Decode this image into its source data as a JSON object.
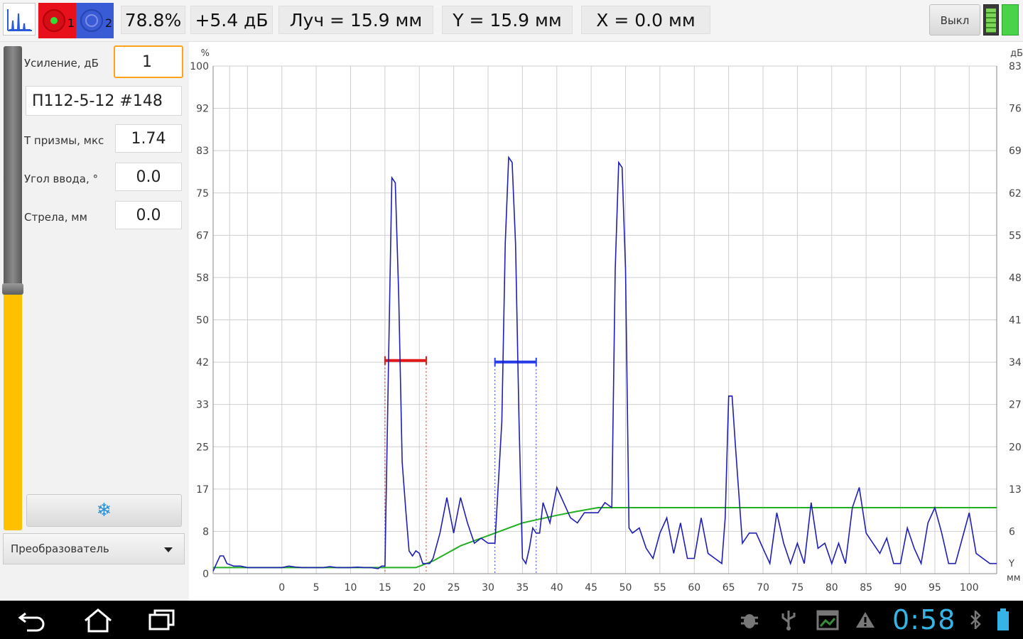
{
  "topbar": {
    "channel1_num": "1",
    "channel2_num": "2",
    "amplitude": "78.8%",
    "gain_delta": "+5.4 дБ",
    "beam": "Луч = 15.9 мм",
    "y_coord": "Y = 15.9 мм",
    "x_coord": "X = 0.0 мм",
    "off_label": "Выкл"
  },
  "left": {
    "gain_label": "Усиление, дБ",
    "gain_value": "1",
    "probe_name": "П112-5-12 #148",
    "prism_label": "Т призмы, мкс",
    "prism_value": "1.74",
    "angle_label": "Угол ввода, °",
    "angle_value": "0.0",
    "arrow_label": "Стрела, мм",
    "arrow_value": "0.0",
    "freeze_icon": "❄",
    "probe_select": "Преобразователь"
  },
  "colors": {
    "signal": "#1f1fb4",
    "dac": "#22b022",
    "gate1": "#e01818",
    "gate2": "#2a3ee8",
    "grid": "#cfcfcf",
    "clock": "#35b5e5"
  },
  "chart_data": {
    "type": "line",
    "xlim": [
      -10,
      104
    ],
    "ylim": [
      0,
      100
    ],
    "x_ticks": [
      0,
      5,
      10,
      15,
      20,
      25,
      30,
      35,
      40,
      45,
      50,
      55,
      60,
      65,
      70,
      75,
      80,
      85,
      90,
      95,
      100
    ],
    "y_ticks_left": [
      "0",
      "8",
      "17",
      "25",
      "33",
      "42",
      "50",
      "58",
      "67",
      "75",
      "83",
      "92",
      "100"
    ],
    "y_ticks_right": [
      "83",
      "76",
      "69",
      "62",
      "55",
      "48",
      "41",
      "34",
      "27",
      "20",
      "13",
      "6"
    ],
    "left_unit": "%",
    "right_unit": "дБ",
    "x_unit_top": "Y",
    "x_unit_bottom": "мм",
    "signal": {
      "x": [
        -10,
        -9.5,
        -9,
        -8.5,
        -8,
        -7,
        -6,
        -5,
        -4,
        -3,
        -2,
        -1,
        0,
        1,
        2,
        3,
        4,
        5,
        6,
        7,
        8,
        9,
        10,
        11,
        12,
        13,
        14,
        14.5,
        15,
        15.5,
        16,
        16.5,
        17,
        17.5,
        18,
        18.5,
        19,
        19.5,
        20,
        20.5,
        21,
        21.5,
        22,
        23,
        24,
        25,
        26,
        27,
        28,
        29,
        30,
        31,
        32,
        32.5,
        33,
        33.5,
        34,
        34.5,
        35,
        35.5,
        36,
        36.5,
        37,
        37.5,
        38,
        39,
        40,
        41,
        42,
        43,
        44,
        45,
        46,
        47,
        48,
        48.5,
        49,
        49.5,
        50,
        50.5,
        51,
        52,
        53,
        54,
        55,
        56,
        57,
        58,
        59,
        60,
        61,
        62,
        63,
        64,
        64.5,
        65,
        65.5,
        66,
        67,
        68,
        69,
        70,
        71,
        72,
        73,
        74,
        75,
        76,
        77,
        78,
        79,
        80,
        81,
        82,
        83,
        84,
        85,
        86,
        87,
        88,
        89,
        90,
        91,
        92,
        93,
        94,
        95,
        96,
        97,
        98,
        99,
        100,
        101,
        102,
        103,
        104
      ],
      "y": [
        0.5,
        2,
        3.5,
        3.5,
        2,
        1.5,
        1.5,
        1.2,
        1.2,
        1.2,
        1.2,
        1.2,
        1.2,
        1.5,
        1.3,
        1.2,
        1.2,
        1.2,
        1.2,
        1.4,
        1.2,
        1.2,
        1.2,
        1.3,
        1.2,
        1.2,
        1,
        1.5,
        1.5,
        40,
        78,
        77,
        55,
        22,
        13,
        4.5,
        3.5,
        4.5,
        4,
        2,
        2,
        2,
        3,
        8,
        15,
        8,
        15,
        10,
        6,
        7,
        6,
        6,
        30,
        65,
        82,
        81,
        65,
        30,
        3,
        2,
        5,
        9,
        8,
        8,
        14,
        10,
        17,
        14,
        11,
        10,
        12,
        12,
        12,
        14,
        13,
        60,
        81,
        80,
        60,
        9,
        8,
        9,
        5,
        3,
        8,
        11,
        4,
        10,
        3,
        3,
        11,
        4,
        3,
        2,
        11,
        35,
        35,
        25,
        6,
        8,
        8,
        5,
        2,
        12,
        6,
        2,
        6,
        2,
        14,
        5,
        6,
        2,
        6,
        2,
        13,
        17,
        8,
        6,
        4,
        7,
        2,
        2,
        9,
        5,
        2,
        10,
        13,
        8,
        2,
        2,
        7,
        12,
        4,
        3,
        2,
        2,
        2,
        2,
        1,
        6
      ]
    },
    "dac_curve": {
      "x": [
        -10,
        19.5,
        22,
        26,
        30,
        35,
        40,
        43,
        46,
        47,
        104
      ],
      "y": [
        1.2,
        1.2,
        2.5,
        5.5,
        7.5,
        10,
        11.5,
        12.3,
        13,
        13,
        13
      ]
    },
    "gates": [
      {
        "name": "1",
        "x_start": 15,
        "x_end": 21,
        "level": 42
      },
      {
        "name": "2",
        "x_start": 31,
        "x_end": 37,
        "level": 41.7
      }
    ]
  },
  "status": {
    "clock": "0:58"
  }
}
